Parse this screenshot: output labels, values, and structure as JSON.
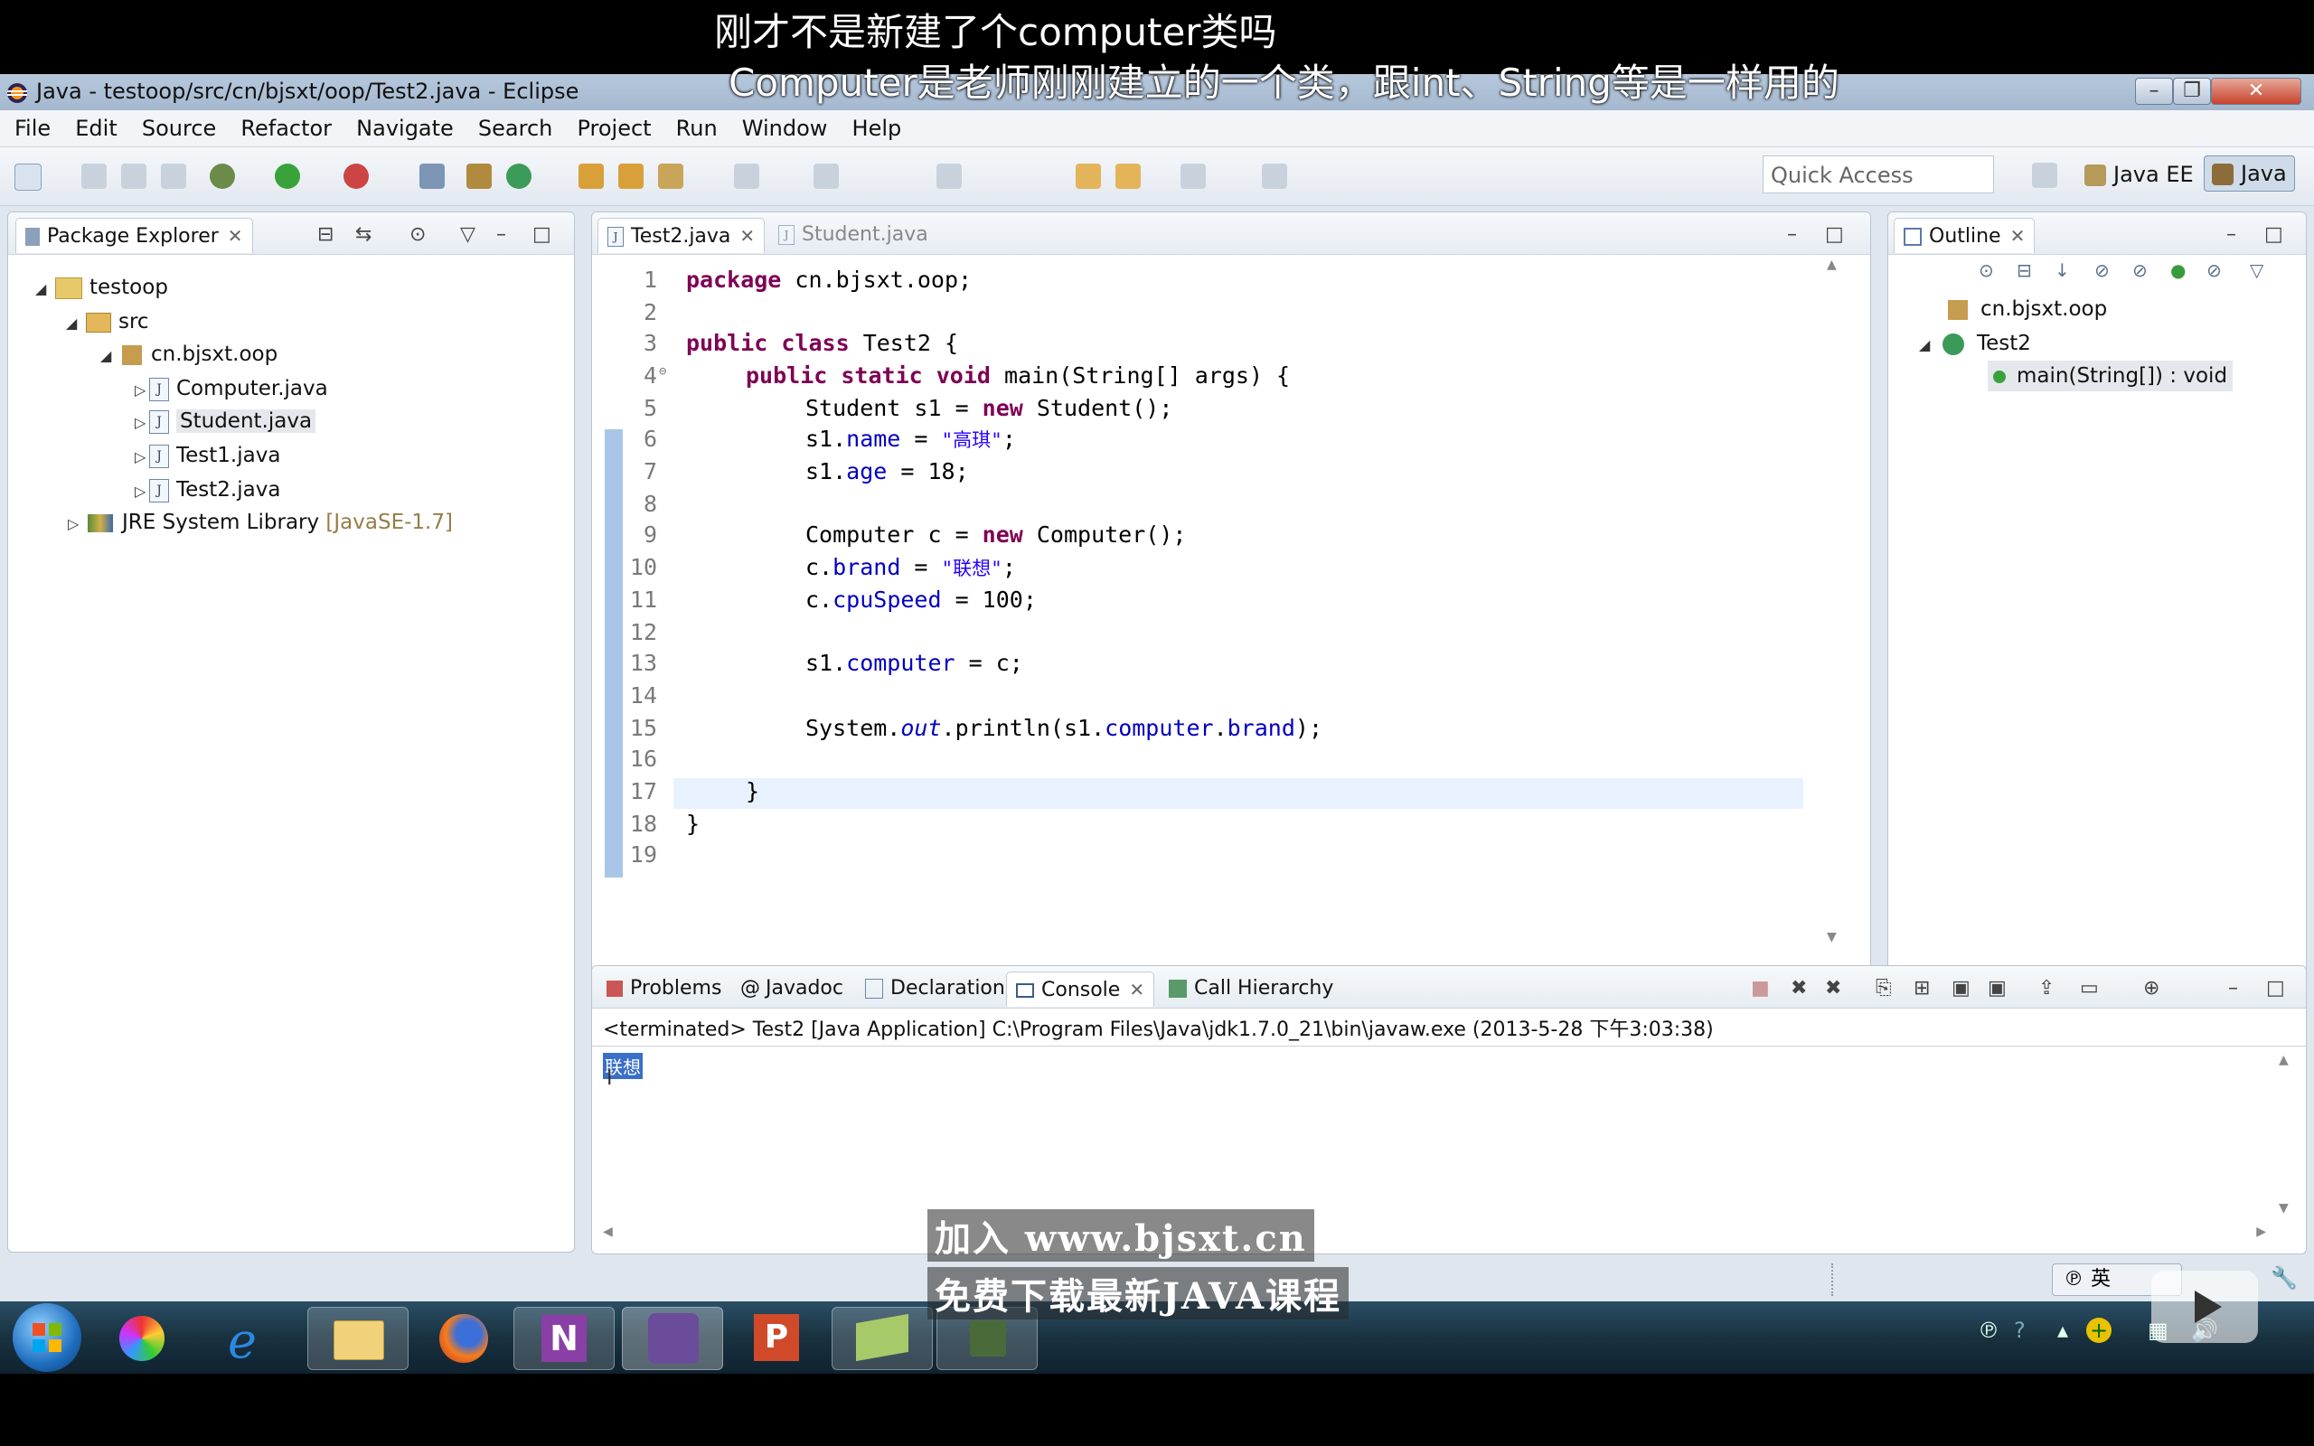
{
  "subtitles": {
    "line1": "刚才不是新建了个computer类吗",
    "line2": "Computer是老师刚刚建立的一个类，跟int、String等是一样用的"
  },
  "window": {
    "title": "Java - testoop/src/cn/bjsxt/oop/Test2.java - Eclipse"
  },
  "menu": [
    "File",
    "Edit",
    "Source",
    "Refactor",
    "Navigate",
    "Search",
    "Project",
    "Run",
    "Window",
    "Help"
  ],
  "toolbar": {
    "quick_access_placeholder": "Quick Access",
    "perspective_javaee": "Java EE",
    "perspective_java": "Java"
  },
  "package_explorer": {
    "tab_label": "Package Explorer",
    "project": "testoop",
    "src": "src",
    "package": "cn.bjsxt.oop",
    "files": [
      "Computer.java",
      "Student.java",
      "Test1.java",
      "Test2.java"
    ],
    "jre": "JRE System Library",
    "jre_version": "[JavaSE-1.7]"
  },
  "editor": {
    "tabs": [
      "Test2.java",
      "Student.java"
    ],
    "lines": [
      {
        "n": "1"
      },
      {
        "n": "2"
      },
      {
        "n": "3"
      },
      {
        "n": "4"
      },
      {
        "n": "5"
      },
      {
        "n": "6"
      },
      {
        "n": "7"
      },
      {
        "n": "8"
      },
      {
        "n": "9"
      },
      {
        "n": "10"
      },
      {
        "n": "11"
      },
      {
        "n": "12"
      },
      {
        "n": "13"
      },
      {
        "n": "14"
      },
      {
        "n": "15"
      },
      {
        "n": "16"
      },
      {
        "n": "17"
      },
      {
        "n": "18"
      },
      {
        "n": "19"
      }
    ],
    "code": {
      "l1_kw": "package",
      "l1_rest": " cn.bjsxt.oop;",
      "l3_kw1": "public",
      "l3_kw2": "class",
      "l3_rest": " Test2 {",
      "l4_kw1": "public",
      "l4_kw2": "static",
      "l4_kw3": "void",
      "l4_rest": " main(String[] args) {",
      "l5_a": "Student s1 = ",
      "l5_kw": "new",
      "l5_b": " Student();",
      "l6_a": "s1.",
      "l6_f": "name",
      "l6_b": " = ",
      "l6_s": "\"高琪\"",
      "l6_c": ";",
      "l7_a": "s1.",
      "l7_f": "age",
      "l7_b": " = 18;",
      "l9_a": "Computer c = ",
      "l9_kw": "new",
      "l9_b": " Computer();",
      "l10_a": "c.",
      "l10_f": "brand",
      "l10_b": " = ",
      "l10_s": "\"联想\"",
      "l10_c": ";",
      "l11_a": "c.",
      "l11_f": "cpuSpeed",
      "l11_b": " = 100;",
      "l13_a": "s1.",
      "l13_f": "computer",
      "l13_b": " = c;",
      "l15_a": "System.",
      "l15_i": "out",
      "l15_b": ".println(s1.",
      "l15_f1": "computer",
      "l15_c": ".",
      "l15_f2": "brand",
      "l15_d": ");",
      "l17": "}",
      "l18": "}"
    }
  },
  "outline": {
    "tab_label": "Outline",
    "package": "cn.bjsxt.oop",
    "class": "Test2",
    "method": "main(String[]) : void"
  },
  "bottom": {
    "tabs": [
      "Problems",
      "Javadoc",
      "Declaration",
      "Console",
      "Call Hierarchy"
    ],
    "console_header": "<terminated> Test2 [Java Application] C:\\Program Files\\Java\\jdk1.7.0_21\\bin\\javaw.exe (2013-5-28 下午3:03:38)",
    "console_output": "联想"
  },
  "watermark": {
    "line1": "加入 www.bjsxt.cn",
    "line2": "免费下载最新JAVA课程"
  },
  "statusbar": {
    "ime": "英"
  }
}
